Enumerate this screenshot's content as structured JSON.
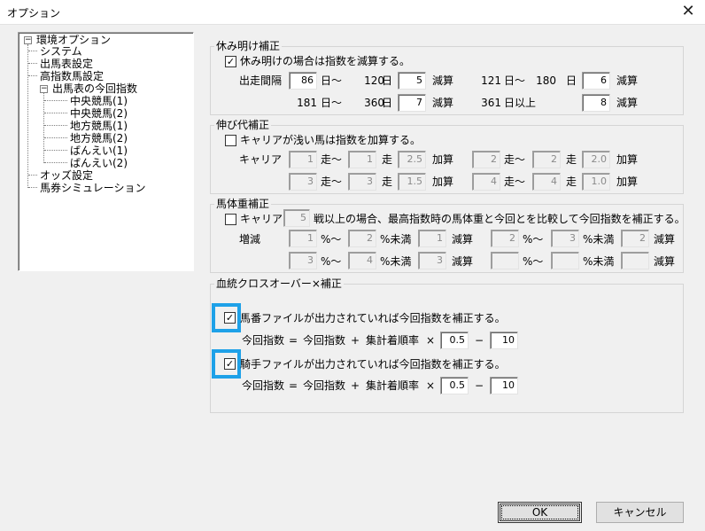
{
  "window": {
    "title": "オプション"
  },
  "tree": {
    "root": "環境オプション",
    "items": [
      "システム",
      "出馬表設定",
      "高指数馬設定"
    ],
    "subgroup": "出馬表の今回指数",
    "subitems": [
      "中央競馬(1)",
      "中央競馬(2)",
      "地方競馬(1)",
      "地方競馬(2)",
      "ばんえい(1)",
      "ばんえい(2)"
    ],
    "tail": [
      "オッズ設定",
      "馬券シミュレーション"
    ]
  },
  "rest": {
    "title": "休み明け補正",
    "checkbox_label": "休み明けの場合は指数を減算する。",
    "checked": true,
    "interval_label": "出走間隔",
    "day": "日",
    "from": "日〜",
    "plus": "日以上",
    "sub": "減算",
    "r1": {
      "a": "86",
      "b": "120",
      "v": "5"
    },
    "r2": {
      "a": "121",
      "b": "180",
      "v": "6"
    },
    "r3": {
      "a": "181",
      "b": "360",
      "v": "7"
    },
    "r4": {
      "a": "361",
      "v": "8"
    }
  },
  "growth": {
    "title": "伸び代補正",
    "checkbox_label": "キャリアが浅い馬は指数を加算する。",
    "checked": false,
    "career": "キャリア",
    "start": "走〜",
    "run": "走",
    "add": "加算",
    "rows": [
      [
        {
          "a": "1",
          "b": "1",
          "v": "2.5"
        },
        {
          "a": "2",
          "b": "2",
          "v": "2.0"
        }
      ],
      [
        {
          "a": "3",
          "b": "3",
          "v": "1.5"
        },
        {
          "a": "4",
          "b": "4",
          "v": "1.0"
        }
      ]
    ]
  },
  "weight": {
    "title": "馬体重補正",
    "checkbox_label": "キャリア",
    "checked": false,
    "career_val": "5",
    "desc": "戦以上の場合、最高指数時の馬体重と今回とを比較して今回指数を補正する。",
    "inc_label": "増減",
    "pct": "%〜",
    "pct_less": "%未満",
    "sub": "減算",
    "rows": [
      [
        {
          "a": "1",
          "b": "2",
          "v": "1"
        },
        {
          "a": "2",
          "b": "3",
          "v": "2"
        }
      ],
      [
        {
          "a": "3",
          "b": "4",
          "v": "3"
        },
        {
          "a": "",
          "b": "",
          "v": ""
        }
      ]
    ]
  },
  "cross": {
    "title": "血統クロスオーバー×補正",
    "horse_label": "馬番ファイルが出力されていれば今回指数を補正する。",
    "horse_checked": true,
    "jockey_label": "騎手ファイルが出力されていれば今回指数を補正する。",
    "jockey_checked": true,
    "formula_left": "今回指数",
    "eq": "=",
    "formula_mid": "今回指数",
    "plus": "+",
    "formula_rate": "集計着順率",
    "times": "×",
    "minus": "−",
    "horse_coef": "0.5",
    "horse_base": "10",
    "jockey_coef": "0.5",
    "jockey_base": "10"
  },
  "buttons": {
    "ok": "OK",
    "cancel": "キャンセル"
  },
  "colors": {
    "highlight": "#1ea1e8"
  }
}
